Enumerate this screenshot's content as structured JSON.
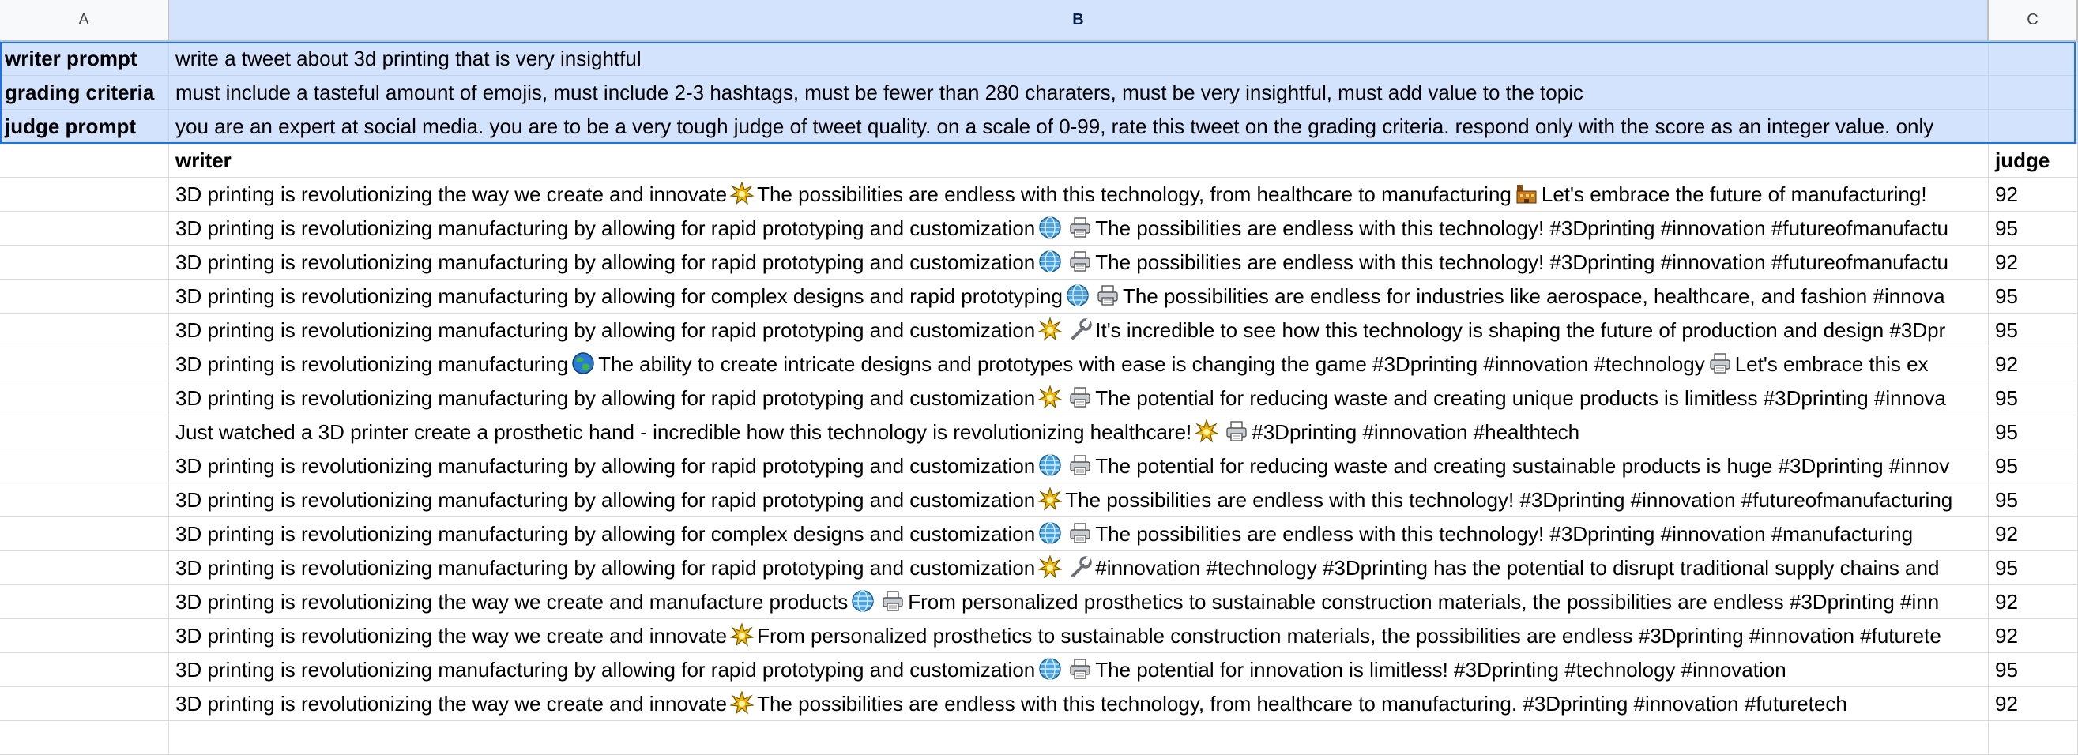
{
  "columns": {
    "a": "A",
    "b": "B",
    "c": "C"
  },
  "meta_rows": [
    {
      "label": "writer prompt",
      "value": "write a tweet about 3d printing that is very insightful"
    },
    {
      "label": "grading criteria",
      "value": "must include a tasteful amount of emojis, must include 2-3 hashtags, must be fewer than 280 charaters, must be very insightful, must add value to the topic"
    },
    {
      "label": "judge prompt",
      "value": "you are an expert at social media. you are to be a very tough judge of tweet quality. on a scale of 0-99, rate this tweet on the grading criteria. respond only with the score as an integer value. only"
    }
  ],
  "headers": {
    "writer": "writer",
    "judge": "judge"
  },
  "emoji_icons": {
    "sparkle": "sparkle-icon",
    "factory": "factory-icon",
    "globe": "globe-icon",
    "earth": "earth-globe-icon",
    "printer": "printer-icon",
    "wrench": "wrench-icon"
  },
  "tweets": [
    {
      "parts": [
        {
          "t": "3D printing is revolutionizing the way we create and innovate"
        },
        {
          "e": "sparkle"
        },
        {
          "t": "The possibilities are endless with this technology, from healthcare to manufacturing"
        },
        {
          "e": "factory"
        },
        {
          "t": "Let's embrace the future of manufacturing!"
        }
      ],
      "score": "92"
    },
    {
      "parts": [
        {
          "t": "3D printing is revolutionizing manufacturing by allowing for rapid prototyping and customization"
        },
        {
          "e": "globe"
        },
        {
          "e": "printer"
        },
        {
          "t": "The possibilities are endless with this technology! #3Dprinting #innovation #futureofmanufactu"
        }
      ],
      "score": "95"
    },
    {
      "parts": [
        {
          "t": "3D printing is revolutionizing manufacturing by allowing for rapid prototyping and customization"
        },
        {
          "e": "globe"
        },
        {
          "e": "printer"
        },
        {
          "t": "The possibilities are endless with this technology! #3Dprinting #innovation #futureofmanufactu"
        }
      ],
      "score": "92"
    },
    {
      "parts": [
        {
          "t": "3D printing is revolutionizing manufacturing by allowing for complex designs and rapid prototyping"
        },
        {
          "e": "globe"
        },
        {
          "e": "printer"
        },
        {
          "t": "The possibilities are endless for industries like aerospace, healthcare, and fashion #innova"
        }
      ],
      "score": "95"
    },
    {
      "parts": [
        {
          "t": "3D printing is revolutionizing manufacturing by allowing for rapid prototyping and customization"
        },
        {
          "e": "sparkle"
        },
        {
          "e": "wrench"
        },
        {
          "t": "It's incredible to see how this technology is shaping the future of production and design #3Dpr"
        }
      ],
      "score": "95"
    },
    {
      "parts": [
        {
          "t": "3D printing is revolutionizing manufacturing"
        },
        {
          "e": "earth"
        },
        {
          "t": "The ability to create intricate designs and prototypes with ease is changing the game #3Dprinting #innovation #technology"
        },
        {
          "e": "printer"
        },
        {
          "t": "Let's embrace this ex"
        }
      ],
      "score": "92"
    },
    {
      "parts": [
        {
          "t": "3D printing is revolutionizing manufacturing by allowing for rapid prototyping and customization"
        },
        {
          "e": "sparkle"
        },
        {
          "e": "printer"
        },
        {
          "t": "The potential for reducing waste and creating unique products is limitless #3Dprinting #innova"
        }
      ],
      "score": "95"
    },
    {
      "parts": [
        {
          "t": "Just watched a 3D printer create a prosthetic hand - incredible how this technology is revolutionizing healthcare!"
        },
        {
          "e": "sparkle"
        },
        {
          "e": "printer"
        },
        {
          "t": "#3Dprinting #innovation #healthtech"
        }
      ],
      "score": "95"
    },
    {
      "parts": [
        {
          "t": "3D printing is revolutionizing manufacturing by allowing for rapid prototyping and customization"
        },
        {
          "e": "globe"
        },
        {
          "e": "printer"
        },
        {
          "t": "The potential for reducing waste and creating sustainable products is huge #3Dprinting #innov"
        }
      ],
      "score": "95"
    },
    {
      "parts": [
        {
          "t": "3D printing is revolutionizing manufacturing by allowing for rapid prototyping and customization"
        },
        {
          "e": "sparkle"
        },
        {
          "t": "The possibilities are endless with this technology! #3Dprinting #innovation #futureofmanufacturing"
        }
      ],
      "score": "95"
    },
    {
      "parts": [
        {
          "t": "3D printing is revolutionizing manufacturing by allowing for complex designs and customization"
        },
        {
          "e": "globe"
        },
        {
          "e": "printer"
        },
        {
          "t": "The possibilities are endless with this technology! #3Dprinting #innovation #manufacturing"
        }
      ],
      "score": "92"
    },
    {
      "parts": [
        {
          "t": "3D printing is revolutionizing manufacturing by allowing for rapid prototyping and customization"
        },
        {
          "e": "sparkle"
        },
        {
          "e": "wrench"
        },
        {
          "t": "#innovation #technology #3Dprinting has the potential to disrupt traditional supply chains and"
        }
      ],
      "score": "95"
    },
    {
      "parts": [
        {
          "t": "3D printing is revolutionizing the way we create and manufacture products"
        },
        {
          "e": "globe"
        },
        {
          "e": "printer"
        },
        {
          "t": "From personalized prosthetics to sustainable construction materials, the possibilities are endless #3Dprinting #inn"
        }
      ],
      "score": "92"
    },
    {
      "parts": [
        {
          "t": "3D printing is revolutionizing the way we create and innovate"
        },
        {
          "e": "sparkle"
        },
        {
          "t": "From personalized prosthetics to sustainable construction materials, the possibilities are endless #3Dprinting #innovation #futurete"
        }
      ],
      "score": "92"
    },
    {
      "parts": [
        {
          "t": "3D printing is revolutionizing manufacturing by allowing for rapid prototyping and customization"
        },
        {
          "e": "globe"
        },
        {
          "e": "printer"
        },
        {
          "t": "The potential for innovation is limitless! #3Dprinting #technology #innovation"
        }
      ],
      "score": "95"
    },
    {
      "parts": [
        {
          "t": "3D printing is revolutionizing the way we create and innovate"
        },
        {
          "e": "sparkle"
        },
        {
          "t": "The possibilities are endless with this technology, from healthcare to manufacturing. #3Dprinting #innovation #futuretech"
        }
      ],
      "score": "92"
    }
  ]
}
